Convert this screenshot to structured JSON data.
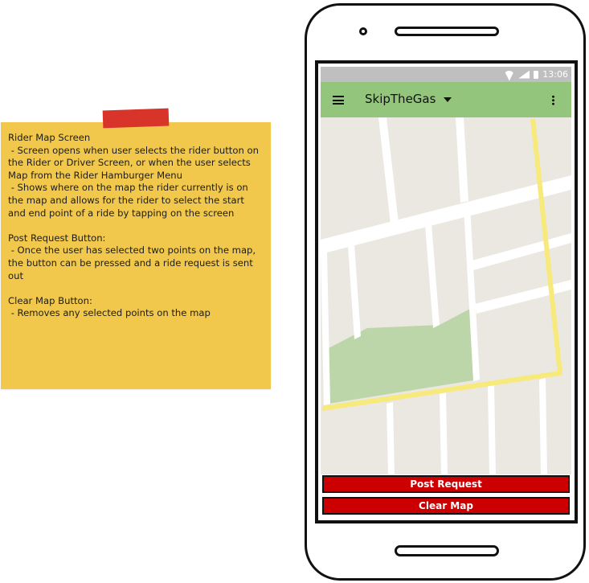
{
  "note": {
    "text": "Rider Map Screen\n - Screen opens when user selects the rider button on the Rider or Driver Screen, or when the user selects Map from the Rider Hamburger Menu\n - Shows where on the map the rider currently is on the map and allows for the rider to select the start and end point of a ride by tapping on the screen\n\nPost Request Button:\n - Once the user has selected two points on the map, the button can be pressed and a ride request is sent out\n\nClear Map Button:\n - Removes any selected points on the map"
  },
  "phone": {
    "status_bar": {
      "time": "13:06",
      "icons": [
        "wifi-icon",
        "signal-icon",
        "battery-icon"
      ]
    },
    "app_bar": {
      "title": "SkipTheGas",
      "icons": [
        "hamburger-menu-icon",
        "dropdown-arrow-icon",
        "overflow-menu-icon"
      ],
      "color": "#94c57c"
    },
    "map": {
      "background": "#ebe8e2",
      "road_color": "#ffffff",
      "route_color": "#f7e97a",
      "park_color": "#bcd6a9"
    },
    "buttons": {
      "post_request_label": "Post Request",
      "clear_map_label": "Clear Map",
      "color": "#cc0000"
    }
  }
}
